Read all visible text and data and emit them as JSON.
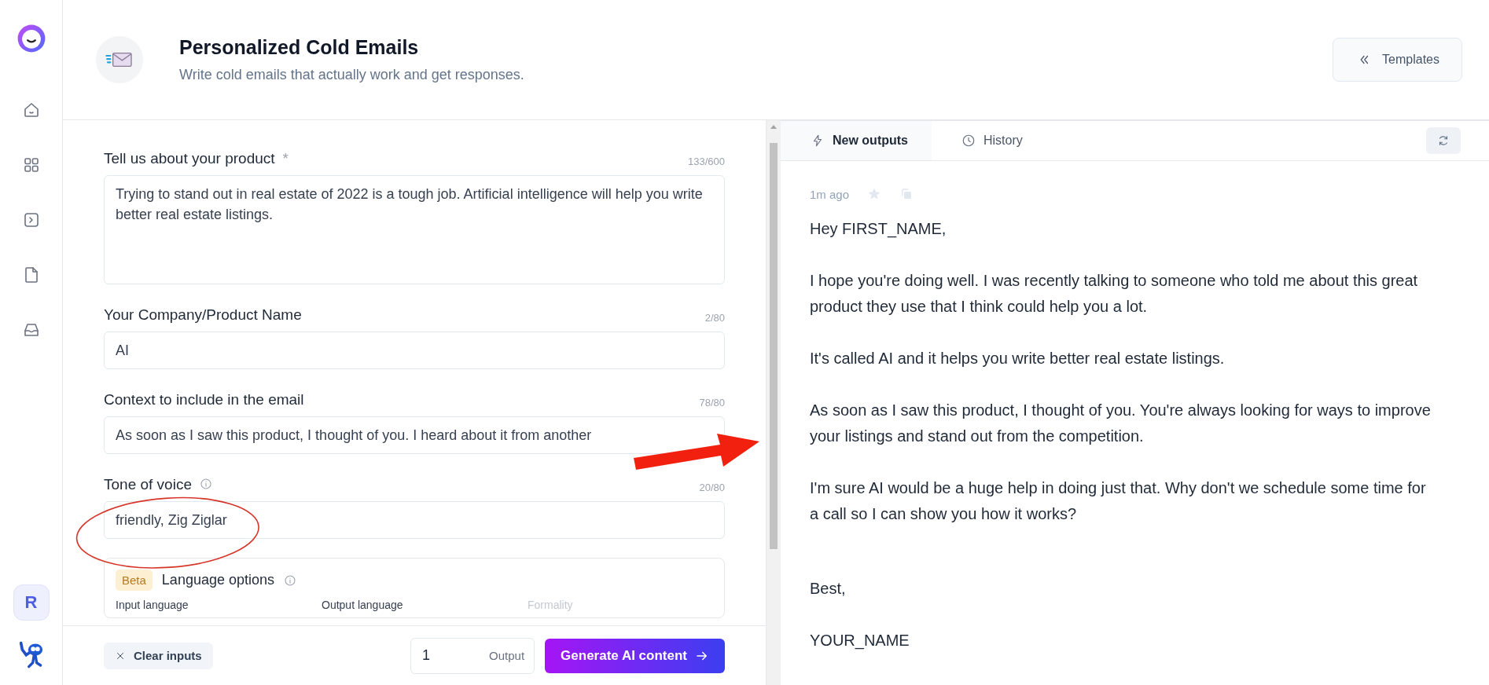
{
  "sidebar": {
    "avatar": "R"
  },
  "header": {
    "title": "Personalized Cold Emails",
    "subtitle": "Write cold emails that actually work and get responses.",
    "templates_button": "Templates"
  },
  "form": {
    "fields": [
      {
        "kind": "textarea",
        "label": "Tell us about your product",
        "marker": "*",
        "info": false,
        "counter": "133/600",
        "value": "Trying to stand out in real estate of 2022 is a tough job. Artificial intelligence will help you write better real estate listings."
      },
      {
        "kind": "input",
        "label": "Your Company/Product Name",
        "info": false,
        "counter": "2/80",
        "value": "AI"
      },
      {
        "kind": "input",
        "label": "Context to include in the email",
        "info": false,
        "counter": "78/80",
        "value": "As soon as I saw this product, I thought of you. I heard about it from another"
      },
      {
        "kind": "input",
        "label": "Tone of voice",
        "info": true,
        "counter": "20/80",
        "value": "friendly, Zig Ziglar"
      }
    ],
    "language_options": {
      "badge": "Beta",
      "title": "Language options",
      "columns": [
        {
          "label": "Input language",
          "disabled": false
        },
        {
          "label": "Output language",
          "disabled": false
        },
        {
          "label": "Formality",
          "disabled": true
        }
      ]
    }
  },
  "footer": {
    "clear_button": "Clear inputs",
    "output_count": "1",
    "output_label": "Output",
    "generate_button": "Generate AI content"
  },
  "output": {
    "tabs": [
      {
        "label": "New outputs",
        "selected": true
      },
      {
        "label": "History",
        "selected": false
      }
    ],
    "result": {
      "time": "1m ago",
      "starred": false,
      "body": [
        "Hey FIRST_NAME,",
        "I hope you're doing well. I was recently talking to someone who told me about this great product they use that I think could help you a lot.",
        "It's called AI and it helps you write better real estate listings.",
        "As soon as I saw this product, I thought of you. You're always looking for ways to improve your listings and stand out from the competition.",
        "I'm sure AI would be a huge help in doing just that. Why don't we schedule some time for a call so I can show you how it works?"
      ],
      "closing": [
        "Best,",
        "YOUR_NAME"
      ]
    }
  }
}
